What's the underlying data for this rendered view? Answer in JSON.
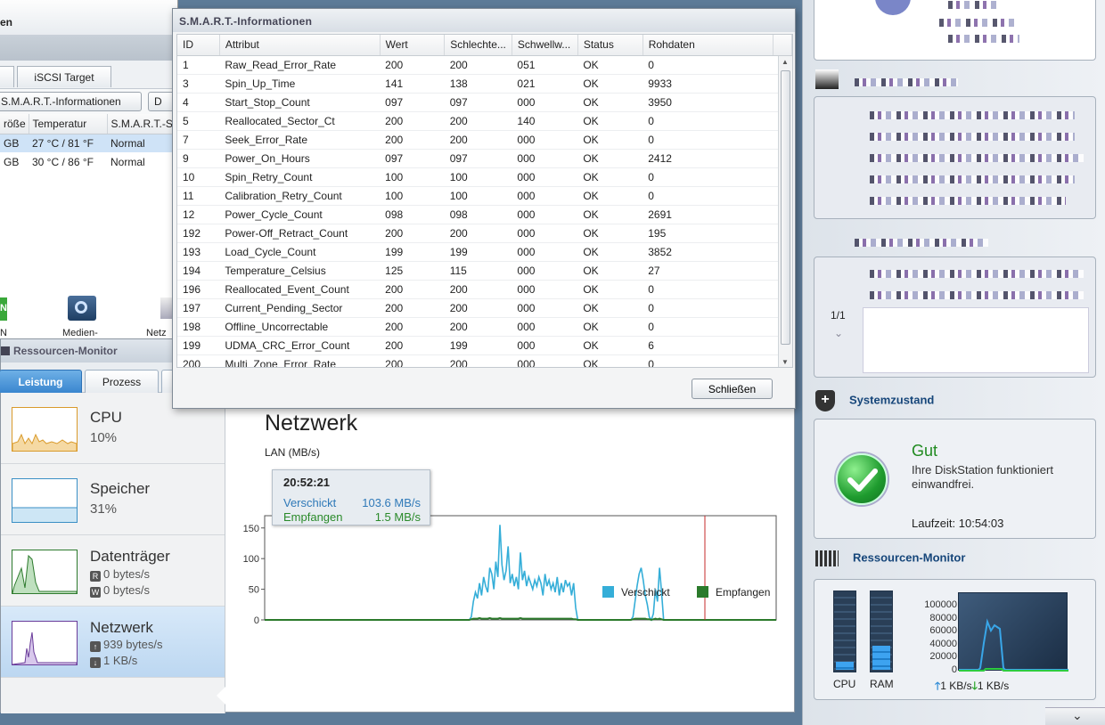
{
  "storage": {
    "title": "en",
    "tab_iscsi": "iSCSI Target",
    "btn_smart": "S.M.A.R.T.-Informationen",
    "btn_d": "D",
    "columns": [
      "röße",
      "Temperatur",
      "S.M.A.R.T.-S"
    ],
    "rows": [
      [
        "GB",
        "27 °C / 81 °F",
        "Normal"
      ],
      [
        "GB",
        "30 °C / 86 °F",
        "Normal"
      ]
    ],
    "icon_n": "N",
    "icon_medien": "Medien-",
    "icon_netz": "Netz"
  },
  "smart": {
    "title": "S.M.A.R.T.-Informationen",
    "columns": [
      "ID",
      "Attribut",
      "Wert",
      "Schlechte...",
      "Schwellw...",
      "Status",
      "Rohdaten"
    ],
    "rows": [
      [
        "1",
        "Raw_Read_Error_Rate",
        "200",
        "200",
        "051",
        "OK",
        "0"
      ],
      [
        "3",
        "Spin_Up_Time",
        "141",
        "138",
        "021",
        "OK",
        "9933"
      ],
      [
        "4",
        "Start_Stop_Count",
        "097",
        "097",
        "000",
        "OK",
        "3950"
      ],
      [
        "5",
        "Reallocated_Sector_Ct",
        "200",
        "200",
        "140",
        "OK",
        "0"
      ],
      [
        "7",
        "Seek_Error_Rate",
        "200",
        "200",
        "000",
        "OK",
        "0"
      ],
      [
        "9",
        "Power_On_Hours",
        "097",
        "097",
        "000",
        "OK",
        "2412"
      ],
      [
        "10",
        "Spin_Retry_Count",
        "100",
        "100",
        "000",
        "OK",
        "0"
      ],
      [
        "11",
        "Calibration_Retry_Count",
        "100",
        "100",
        "000",
        "OK",
        "0"
      ],
      [
        "12",
        "Power_Cycle_Count",
        "098",
        "098",
        "000",
        "OK",
        "2691"
      ],
      [
        "192",
        "Power-Off_Retract_Count",
        "200",
        "200",
        "000",
        "OK",
        "195"
      ],
      [
        "193",
        "Load_Cycle_Count",
        "199",
        "199",
        "000",
        "OK",
        "3852"
      ],
      [
        "194",
        "Temperature_Celsius",
        "125",
        "115",
        "000",
        "OK",
        "27"
      ],
      [
        "196",
        "Reallocated_Event_Count",
        "200",
        "200",
        "000",
        "OK",
        "0"
      ],
      [
        "197",
        "Current_Pending_Sector",
        "200",
        "200",
        "000",
        "OK",
        "0"
      ],
      [
        "198",
        "Offline_Uncorrectable",
        "200",
        "200",
        "000",
        "OK",
        "0"
      ],
      [
        "199",
        "UDMA_CRC_Error_Count",
        "200",
        "199",
        "000",
        "OK",
        "6"
      ],
      [
        "200",
        "Multi_Zone_Error_Rate",
        "200",
        "200",
        "000",
        "OK",
        "0"
      ]
    ],
    "close_label": "Schließen"
  },
  "resmon": {
    "title": "Ressourcen-Monitor",
    "tabs": [
      "Leistung",
      "Prozess"
    ],
    "sidebar": {
      "cpu": {
        "name": "CPU",
        "value": "10%"
      },
      "mem": {
        "name": "Speicher",
        "value": "31%"
      },
      "disk": {
        "name": "Datenträger",
        "read": "0 bytes/s",
        "write": "0 bytes/s",
        "read_icon": "R",
        "write_icon": "W"
      },
      "net": {
        "name": "Netzwerk",
        "up": "939 bytes/s",
        "down": "1 KB/s"
      }
    },
    "main_title": "Netzwerk",
    "tooltip": {
      "time": "20:52:21",
      "sent_label": "Verschickt",
      "sent_value": "103.6 MB/s",
      "recv_label": "Empfangen",
      "recv_value": "1.5 MB/s"
    },
    "legend": {
      "sent": "Verschickt",
      "recv": "Empfangen"
    }
  },
  "chart_data": {
    "type": "line",
    "title": "Netzwerk",
    "ylabel": "LAN (MB/s)",
    "ylim": [
      0,
      170
    ],
    "yticks": [
      0,
      50,
      100,
      150
    ],
    "colors": {
      "sent": "#35aed8",
      "recv": "#2b7a2b"
    },
    "series": [
      {
        "name": "Verschickt",
        "values": [
          0,
          0,
          0,
          0,
          0,
          0,
          0,
          0,
          0,
          0,
          0,
          0,
          0,
          0,
          0,
          0,
          0,
          0,
          0,
          0,
          0,
          0,
          0,
          0,
          0,
          0,
          0,
          0,
          0,
          0,
          0,
          0,
          0,
          0,
          0,
          0,
          0,
          0,
          0,
          0,
          0,
          0,
          0,
          0,
          0,
          0,
          0,
          0,
          0,
          0,
          0,
          0,
          0,
          0,
          0,
          0,
          0,
          0,
          0,
          0,
          0,
          0,
          0,
          0,
          0,
          0,
          0,
          0,
          0,
          0,
          0,
          0,
          0,
          0,
          0,
          0,
          0,
          0,
          0,
          0,
          0,
          0,
          0,
          0,
          0,
          0,
          0,
          0,
          0,
          0,
          0,
          0,
          0,
          0,
          0,
          0,
          0,
          0,
          0,
          0,
          0,
          5,
          30,
          45,
          35,
          60,
          40,
          70,
          55,
          45,
          85,
          75,
          50,
          95,
          70,
          155,
          90,
          65,
          80,
          120,
          60,
          75,
          55,
          70,
          50,
          110,
          65,
          80,
          55,
          70,
          60,
          50,
          65,
          55,
          70,
          60,
          40,
          75,
          55,
          65,
          50,
          60,
          45,
          70,
          40,
          60,
          45,
          65,
          55,
          60,
          40,
          60,
          20,
          0,
          0,
          0,
          0,
          0,
          0,
          0,
          0,
          0,
          0,
          0,
          0,
          0,
          0,
          0,
          0,
          0,
          0,
          0,
          0,
          0,
          0,
          0,
          0,
          0,
          0,
          0,
          5,
          30,
          55,
          75,
          85,
          65,
          40,
          25,
          5,
          0,
          10,
          50,
          30,
          85,
          45,
          0,
          0,
          0,
          0,
          0,
          0,
          0,
          0,
          0,
          0,
          0,
          0,
          0,
          0,
          0,
          0,
          0,
          0,
          0,
          0,
          0,
          0,
          0,
          0,
          0,
          0,
          0,
          0,
          0,
          0,
          0,
          0,
          0,
          0,
          0,
          0,
          0,
          0,
          0,
          0,
          0,
          0,
          0,
          0,
          0,
          0,
          0,
          0,
          0,
          0,
          0,
          0,
          0,
          0,
          0,
          0
        ]
      },
      {
        "name": "Empfangen",
        "values": [
          0,
          0,
          0,
          0,
          0,
          0,
          0,
          0,
          0,
          0,
          0,
          0,
          0,
          0,
          0,
          0,
          0,
          0,
          0,
          0,
          0,
          0,
          0,
          0,
          0,
          0,
          0,
          0,
          0,
          0,
          0,
          0,
          0,
          0,
          0,
          0,
          0,
          0,
          0,
          0,
          0,
          0,
          0,
          0,
          0,
          0,
          0,
          0,
          0,
          0,
          0,
          0,
          0,
          0,
          0,
          0,
          0,
          0,
          0,
          0,
          0,
          0,
          0,
          0,
          0,
          0,
          0,
          0,
          0,
          0,
          0,
          0,
          0,
          0,
          0,
          0,
          0,
          0,
          0,
          0,
          0,
          0,
          0,
          0,
          0,
          0,
          0,
          0,
          0,
          0,
          0,
          0,
          0,
          0,
          0,
          0,
          0,
          0,
          0,
          0,
          0,
          1,
          2,
          2,
          2,
          3,
          2,
          2,
          2,
          2,
          3,
          2,
          2,
          2,
          2,
          3,
          2,
          2,
          2,
          2,
          2,
          2,
          2,
          2,
          2,
          3,
          2,
          2,
          2,
          2,
          2,
          2,
          2,
          2,
          2,
          2,
          2,
          2,
          2,
          2,
          2,
          2,
          2,
          2,
          2,
          2,
          2,
          2,
          2,
          2,
          2,
          1,
          1,
          0,
          0,
          0,
          0,
          0,
          0,
          0,
          0,
          0,
          0,
          0,
          0,
          0,
          0,
          0,
          0,
          0,
          0,
          0,
          0,
          0,
          0,
          0,
          0,
          0,
          0,
          0,
          1,
          2,
          2,
          2,
          2,
          2,
          2,
          1,
          1,
          0,
          1,
          2,
          1,
          2,
          1,
          0,
          0,
          0,
          0,
          0,
          0,
          0,
          0,
          0,
          0,
          0,
          0,
          0,
          0,
          0,
          0,
          0,
          0,
          0,
          0,
          0,
          0,
          0,
          0,
          0,
          0,
          0,
          0,
          0,
          0,
          0,
          0,
          0,
          0,
          0,
          0,
          0,
          0,
          0,
          0,
          0,
          0,
          0,
          0,
          0,
          0,
          0,
          0,
          0,
          0,
          0,
          0,
          0,
          0,
          0,
          0
        ]
      }
    ]
  },
  "panel": {
    "systemzustand": {
      "title": "Systemzustand",
      "status": "Gut",
      "message": "Ihre DiskStation funktioniert einwandfrei.",
      "uptime": "Laufzeit: 10:54:03"
    },
    "connections": {
      "pager": "1/1"
    },
    "resmon_widget": {
      "title": "Ressourcen-Monitor",
      "cpu_label": "CPU",
      "ram_label": "RAM",
      "cpu_level": 0.1,
      "ram_level": 0.31,
      "yticks": [
        "100000",
        "80000",
        "60000",
        "40000",
        "20000",
        "0"
      ],
      "up": "1 KB/s",
      "down": "1 KB/s"
    }
  }
}
